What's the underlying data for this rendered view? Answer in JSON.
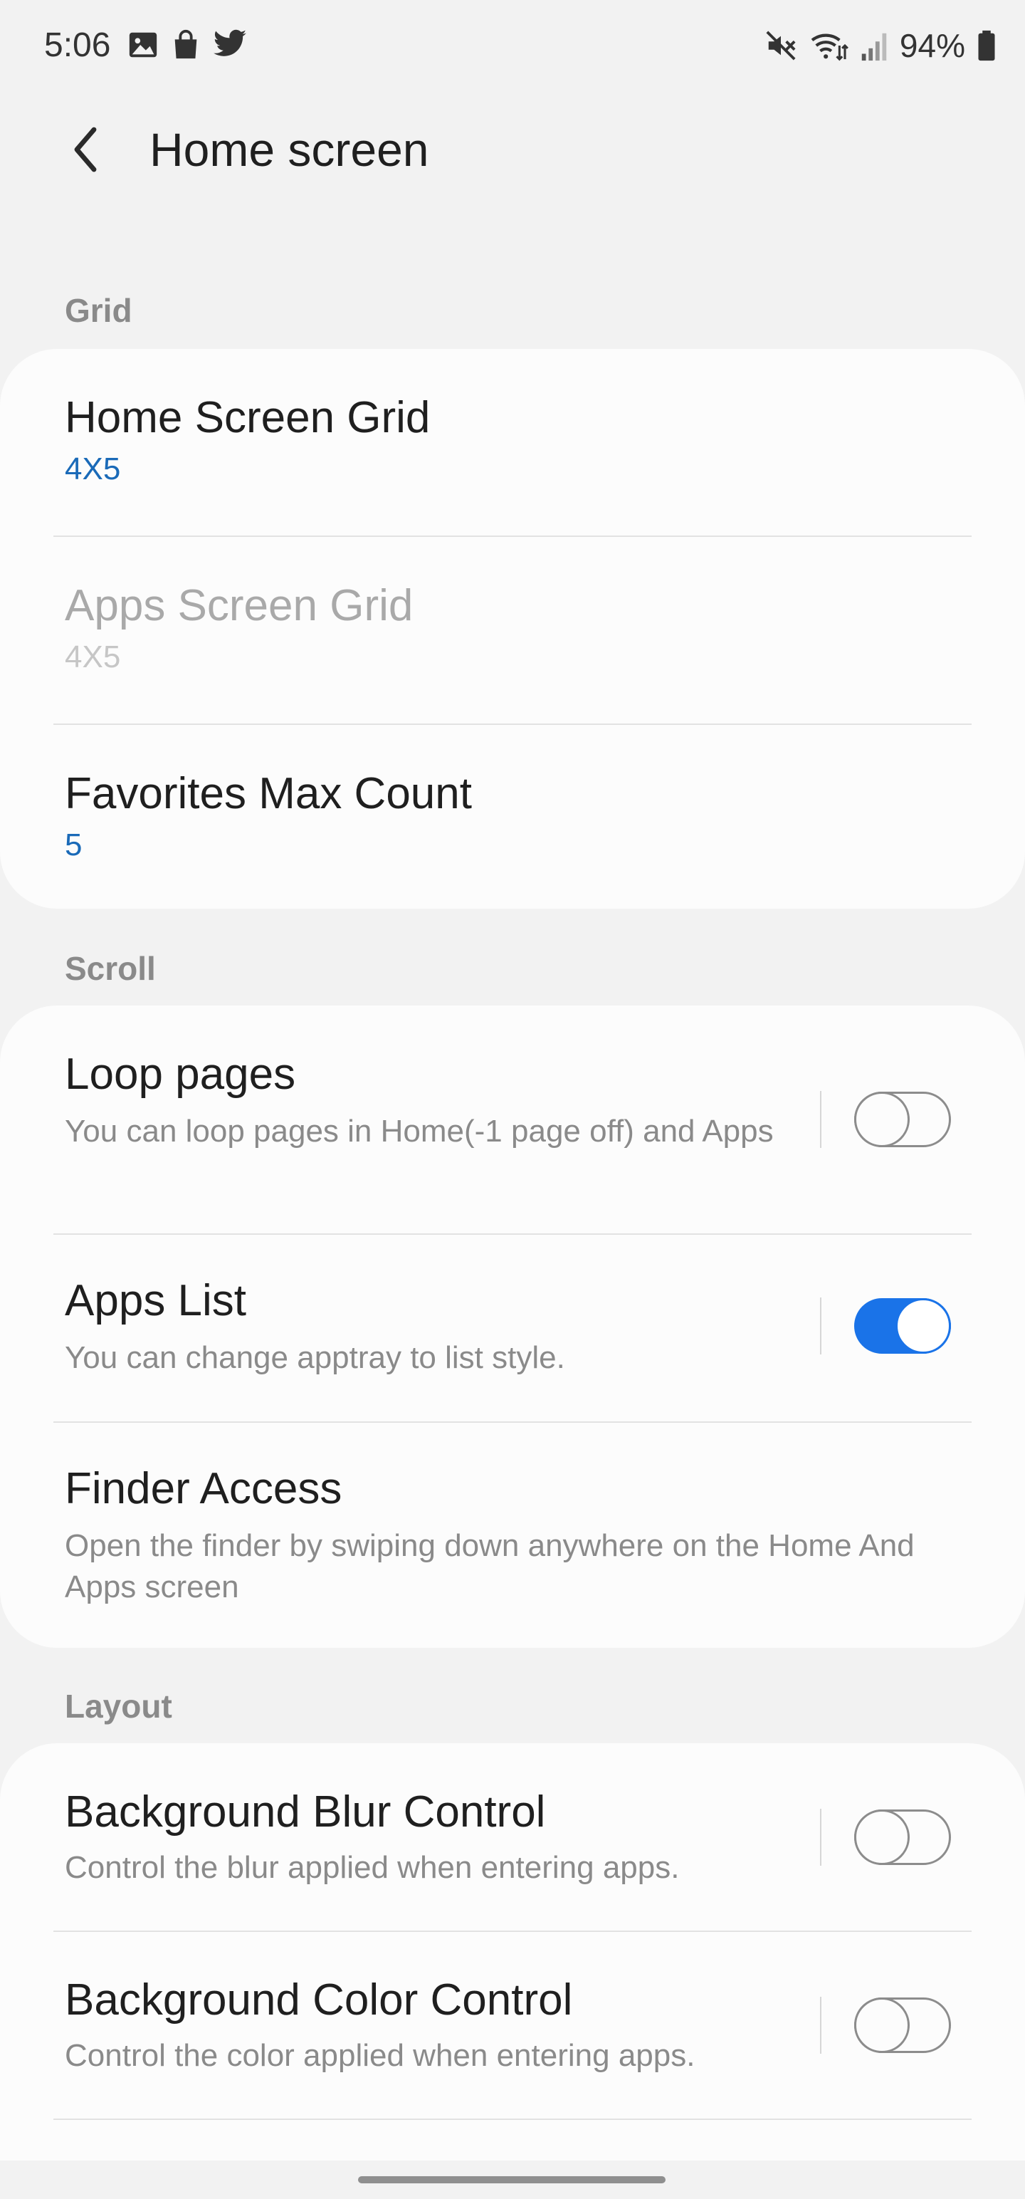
{
  "status_bar": {
    "time": "5:06",
    "left_icons": [
      "gallery-icon",
      "shopping-bag-icon",
      "twitter-icon"
    ],
    "right_icons": [
      "mute-icon",
      "wifi-icon",
      "signal-icon",
      "battery-icon"
    ],
    "battery": "94%"
  },
  "app_bar": {
    "title": "Home screen",
    "back_icon": "chevron-left-icon"
  },
  "sections": {
    "grid": {
      "header": "Grid",
      "items": [
        {
          "title": "Home Screen Grid",
          "value": "4X5",
          "enabled": true
        },
        {
          "title": "Apps Screen Grid",
          "value": "4X5",
          "enabled": false
        },
        {
          "title": "Favorites Max Count",
          "value": "5",
          "enabled": true
        }
      ]
    },
    "scroll": {
      "header": "Scroll",
      "items": [
        {
          "title": "Loop pages",
          "subtitle": "You can loop pages in Home(-1 page off) and Apps",
          "toggle": false
        },
        {
          "title": "Apps List",
          "subtitle": "You can change apptray to list style.",
          "toggle": true
        },
        {
          "title": "Finder Access",
          "subtitle": "Open the finder by swiping down anywhere on the Home And Apps screen"
        }
      ]
    },
    "layout": {
      "header": "Layout",
      "items": [
        {
          "title": "Background Blur Control",
          "subtitle": "Control the blur applied when entering apps.",
          "toggle": false
        },
        {
          "title": "Background Color Control",
          "subtitle": "Control the color applied when entering apps.",
          "toggle": false
        }
      ]
    }
  },
  "colors": {
    "accent": "#1a73e8",
    "value_text": "#1a6ab8",
    "background": "#f2f2f2",
    "card": "#fcfcfc"
  }
}
